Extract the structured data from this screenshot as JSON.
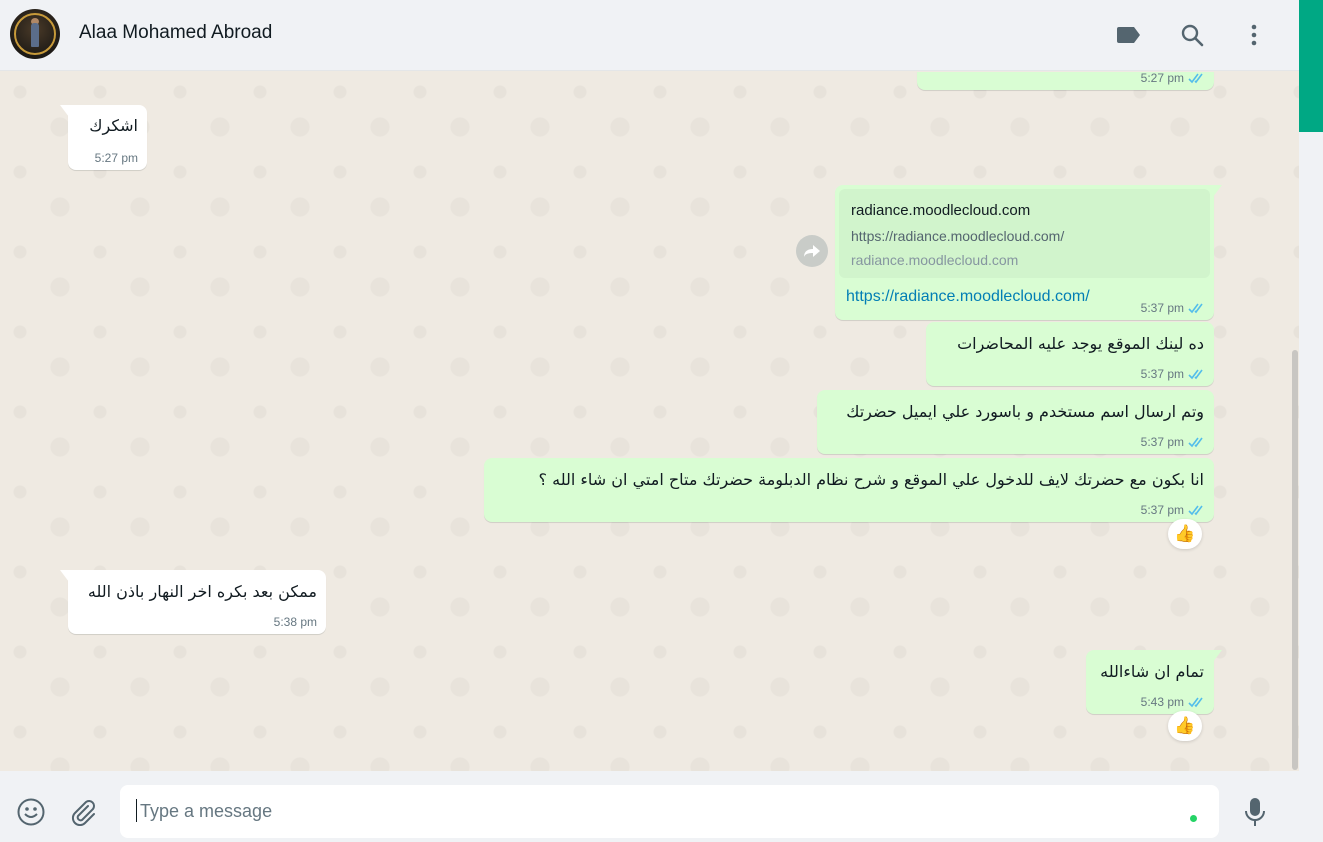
{
  "header": {
    "contact_name": "Alaa Mohamed Abroad",
    "icons": [
      "label-icon",
      "search-icon",
      "menu-icon"
    ]
  },
  "messages": [
    {
      "direction": "out",
      "text": "",
      "time": "5:27 pm",
      "status": "read"
    },
    {
      "direction": "in",
      "text": "اشكرك",
      "time": "5:27 pm"
    },
    {
      "direction": "out",
      "type": "link",
      "preview": {
        "title": "radiance.moodlecloud.com",
        "url": "https://radiance.moodlecloud.com/",
        "domain": "radiance.moodlecloud.com"
      },
      "text": "https://radiance.moodlecloud.com/",
      "time": "5:37 pm",
      "status": "read"
    },
    {
      "direction": "out",
      "text": "ده لينك الموقع يوجد عليه المحاضرات",
      "time": "5:37 pm",
      "status": "read"
    },
    {
      "direction": "out",
      "text": "وتم ارسال اسم مستخدم و باسورد علي ايميل حضرتك",
      "time": "5:37 pm",
      "status": "read"
    },
    {
      "direction": "out",
      "text": "انا بكون مع حضرتك لايف للدخول علي الموقع و شرح نظام الدبلومة حضرتك متاح امتي ان شاء الله ؟",
      "time": "5:37 pm",
      "status": "read",
      "reaction": "👍"
    },
    {
      "direction": "in",
      "text": "ممكن بعد بكره اخر النهار باذن الله",
      "time": "5:38 pm"
    },
    {
      "direction": "out",
      "text": "تمام ان شاءالله",
      "time": "5:43 pm",
      "status": "read",
      "reaction": "👍"
    }
  ],
  "composer": {
    "placeholder": "Type a message",
    "icons": [
      "emoji-icon",
      "attach-icon",
      "microphone-icon"
    ]
  },
  "colors": {
    "accent": "#00a884",
    "bubble_out": "#d9fdd3",
    "bubble_in": "#ffffff",
    "read_ticks": "#53bdeb",
    "link": "#027eb5"
  }
}
